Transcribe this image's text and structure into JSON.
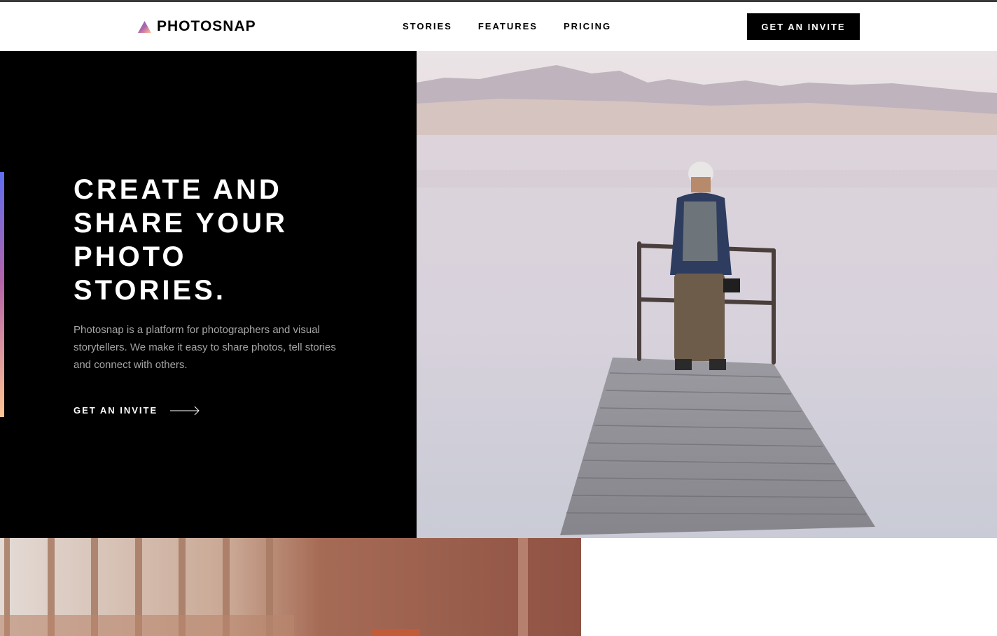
{
  "brand": {
    "name": "PHOTOSNAP",
    "icon": "triangle-logo-icon"
  },
  "nav": {
    "items": [
      {
        "label": "STORIES"
      },
      {
        "label": "FEATURES"
      },
      {
        "label": "PRICING"
      }
    ],
    "cta_label": "GET AN INVITE"
  },
  "hero": {
    "title_lines": [
      "CREATE AND",
      "SHARE YOUR",
      "PHOTO",
      "STORIES."
    ],
    "description": "Photosnap is a platform for photographers and visual storytellers. We make it easy to share photos, tell stories and connect with others.",
    "cta_label": "GET AN INVITE",
    "cta_icon": "arrow-right-icon",
    "image": "photographer-on-pier-image"
  },
  "next_section": {
    "image": "interior-photo-image"
  },
  "colors": {
    "black": "#000000",
    "white": "#ffffff",
    "gradient_start": "#5f6ef0",
    "gradient_mid": "#b563a8",
    "gradient_end": "#ffc593",
    "body_text": "#a6a6a6"
  }
}
